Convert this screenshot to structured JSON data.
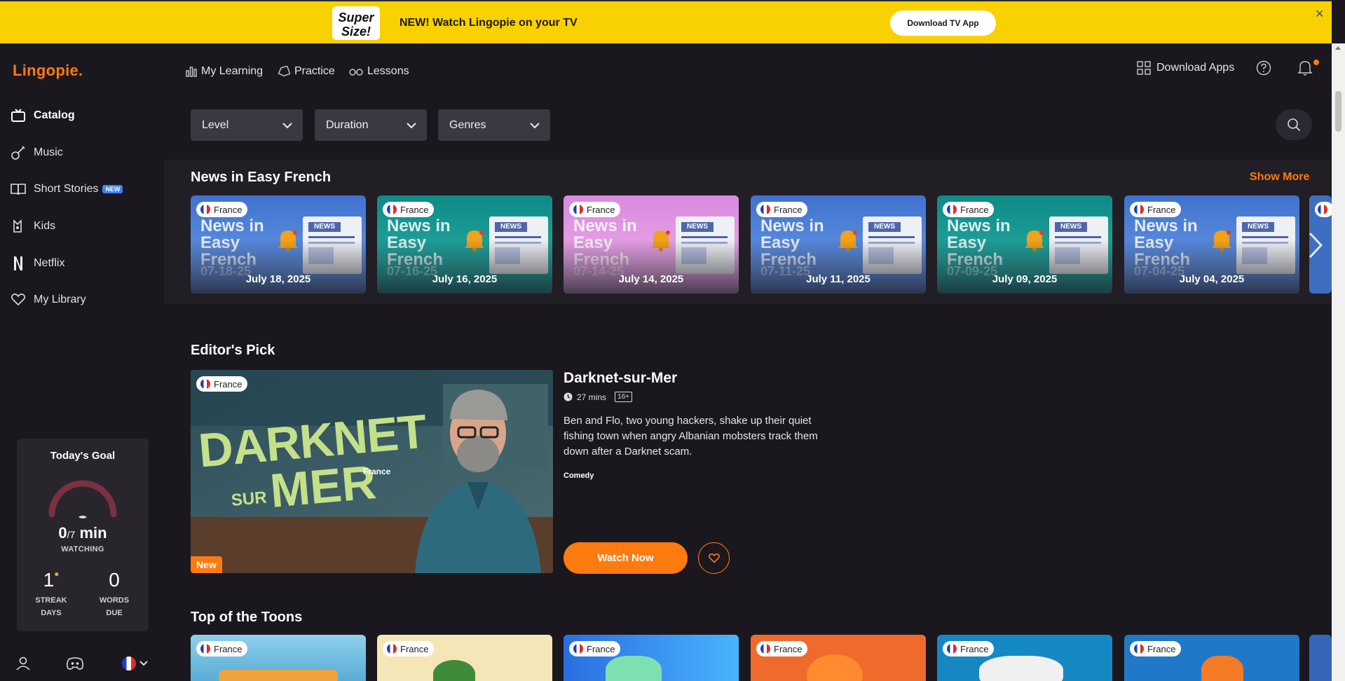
{
  "banner": {
    "logo_text": "Super Size!",
    "message": "NEW! Watch Lingopie on your TV",
    "button": "Download TV App",
    "close": "✕"
  },
  "brand": "Lingopie.",
  "sidebar": {
    "items": [
      {
        "label": "Catalog",
        "icon": "tv-icon"
      },
      {
        "label": "Music",
        "icon": "guitar-icon"
      },
      {
        "label": "Short Stories",
        "icon": "book-icon",
        "badge": "NEW"
      },
      {
        "label": "Kids",
        "icon": "kids-icon"
      },
      {
        "label": "Netflix",
        "icon": "netflix-icon"
      },
      {
        "label": "My Library",
        "icon": "heart-icon"
      }
    ]
  },
  "goal": {
    "title": "Today's Goal",
    "minutes_done": "0",
    "minutes_goal": "/7",
    "minutes_unit": "min",
    "watching_label": "WATCHING",
    "streak_value": "1",
    "streak_label_1": "STREAK",
    "streak_label_2": "DAYS",
    "words_value": "0",
    "words_label_1": "WORDS",
    "words_label_2": "DUE",
    "progress_fraction": 0
  },
  "topnav": {
    "my_learning": "My Learning",
    "practice": "Practice",
    "lessons": "Lessons",
    "download_apps": "Download Apps"
  },
  "filters": {
    "level": "Level",
    "duration": "Duration",
    "genres": "Genres"
  },
  "news": {
    "title": "News in Easy French",
    "show_more": "Show More",
    "country": "France",
    "thumb_heading": "News in Easy French",
    "thumb_label": "NEWS",
    "cards": [
      {
        "date": "July 18, 2025",
        "thumb_date": "07-18-25",
        "theme": "blue"
      },
      {
        "date": "July 16, 2025",
        "thumb_date": "07-16-25",
        "theme": "teal"
      },
      {
        "date": "July 14, 2025",
        "thumb_date": "07-14-25",
        "theme": "pink"
      },
      {
        "date": "July 11, 2025",
        "thumb_date": "07-11-25",
        "theme": "blue"
      },
      {
        "date": "July 09, 2025",
        "thumb_date": "07-09-25",
        "theme": "teal"
      },
      {
        "date": "July 04, 2025",
        "thumb_date": "07-04-25",
        "theme": "blue"
      }
    ]
  },
  "editors_pick": {
    "section_title": "Editor's Pick",
    "country": "France",
    "poster_line1": "DARKNET",
    "poster_line2": "SUR",
    "poster_line3": "MER",
    "poster_brand": "France",
    "new_badge": "New",
    "title": "Darknet-sur-Mer",
    "duration": "27 mins",
    "age_rating": "16+",
    "description": "Ben and Flo, two young hackers, shake up their quiet fishing town when angry Albanian mobsters track them down after a Darknet scam.",
    "genre": "Comedy",
    "watch_button": "Watch Now"
  },
  "toons": {
    "title": "Top of the Toons",
    "country": "France"
  },
  "colors": {
    "accent": "#ff7a0f",
    "banner": "#f9d100",
    "background": "#1b171e",
    "panel": "#29252d"
  }
}
